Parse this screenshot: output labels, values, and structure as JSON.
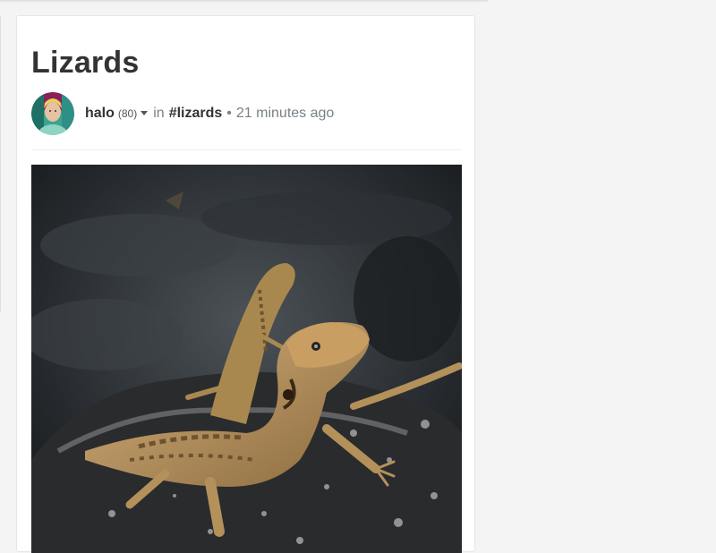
{
  "post": {
    "title": "Lizards",
    "author": "halo",
    "reputation": "(80)",
    "in_label": "in",
    "community": "#lizards",
    "separator": "•",
    "time": "21 minutes ago"
  },
  "icons": {
    "avatar": "user-avatar",
    "dropdown": "caret-down-icon"
  },
  "colors": {
    "text_dark": "#333333",
    "text_muted": "#788187",
    "background": "#f4f4f4",
    "card": "#ffffff"
  }
}
